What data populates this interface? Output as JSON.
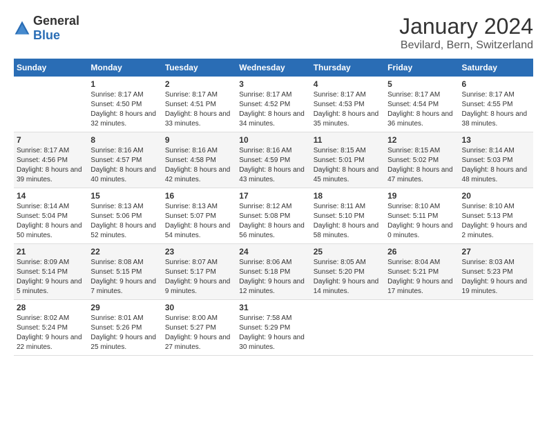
{
  "logo": {
    "general": "General",
    "blue": "Blue"
  },
  "title": "January 2024",
  "subtitle": "Bevilard, Bern, Switzerland",
  "days_header": [
    "Sunday",
    "Monday",
    "Tuesday",
    "Wednesday",
    "Thursday",
    "Friday",
    "Saturday"
  ],
  "weeks": [
    [
      {
        "day": "",
        "sunrise": "",
        "sunset": "",
        "daylight": ""
      },
      {
        "day": "1",
        "sunrise": "Sunrise: 8:17 AM",
        "sunset": "Sunset: 4:50 PM",
        "daylight": "Daylight: 8 hours and 32 minutes."
      },
      {
        "day": "2",
        "sunrise": "Sunrise: 8:17 AM",
        "sunset": "Sunset: 4:51 PM",
        "daylight": "Daylight: 8 hours and 33 minutes."
      },
      {
        "day": "3",
        "sunrise": "Sunrise: 8:17 AM",
        "sunset": "Sunset: 4:52 PM",
        "daylight": "Daylight: 8 hours and 34 minutes."
      },
      {
        "day": "4",
        "sunrise": "Sunrise: 8:17 AM",
        "sunset": "Sunset: 4:53 PM",
        "daylight": "Daylight: 8 hours and 35 minutes."
      },
      {
        "day": "5",
        "sunrise": "Sunrise: 8:17 AM",
        "sunset": "Sunset: 4:54 PM",
        "daylight": "Daylight: 8 hours and 36 minutes."
      },
      {
        "day": "6",
        "sunrise": "Sunrise: 8:17 AM",
        "sunset": "Sunset: 4:55 PM",
        "daylight": "Daylight: 8 hours and 38 minutes."
      }
    ],
    [
      {
        "day": "7",
        "sunrise": "Sunrise: 8:17 AM",
        "sunset": "Sunset: 4:56 PM",
        "daylight": "Daylight: 8 hours and 39 minutes."
      },
      {
        "day": "8",
        "sunrise": "Sunrise: 8:16 AM",
        "sunset": "Sunset: 4:57 PM",
        "daylight": "Daylight: 8 hours and 40 minutes."
      },
      {
        "day": "9",
        "sunrise": "Sunrise: 8:16 AM",
        "sunset": "Sunset: 4:58 PM",
        "daylight": "Daylight: 8 hours and 42 minutes."
      },
      {
        "day": "10",
        "sunrise": "Sunrise: 8:16 AM",
        "sunset": "Sunset: 4:59 PM",
        "daylight": "Daylight: 8 hours and 43 minutes."
      },
      {
        "day": "11",
        "sunrise": "Sunrise: 8:15 AM",
        "sunset": "Sunset: 5:01 PM",
        "daylight": "Daylight: 8 hours and 45 minutes."
      },
      {
        "day": "12",
        "sunrise": "Sunrise: 8:15 AM",
        "sunset": "Sunset: 5:02 PM",
        "daylight": "Daylight: 8 hours and 47 minutes."
      },
      {
        "day": "13",
        "sunrise": "Sunrise: 8:14 AM",
        "sunset": "Sunset: 5:03 PM",
        "daylight": "Daylight: 8 hours and 48 minutes."
      }
    ],
    [
      {
        "day": "14",
        "sunrise": "Sunrise: 8:14 AM",
        "sunset": "Sunset: 5:04 PM",
        "daylight": "Daylight: 8 hours and 50 minutes."
      },
      {
        "day": "15",
        "sunrise": "Sunrise: 8:13 AM",
        "sunset": "Sunset: 5:06 PM",
        "daylight": "Daylight: 8 hours and 52 minutes."
      },
      {
        "day": "16",
        "sunrise": "Sunrise: 8:13 AM",
        "sunset": "Sunset: 5:07 PM",
        "daylight": "Daylight: 8 hours and 54 minutes."
      },
      {
        "day": "17",
        "sunrise": "Sunrise: 8:12 AM",
        "sunset": "Sunset: 5:08 PM",
        "daylight": "Daylight: 8 hours and 56 minutes."
      },
      {
        "day": "18",
        "sunrise": "Sunrise: 8:11 AM",
        "sunset": "Sunset: 5:10 PM",
        "daylight": "Daylight: 8 hours and 58 minutes."
      },
      {
        "day": "19",
        "sunrise": "Sunrise: 8:10 AM",
        "sunset": "Sunset: 5:11 PM",
        "daylight": "Daylight: 9 hours and 0 minutes."
      },
      {
        "day": "20",
        "sunrise": "Sunrise: 8:10 AM",
        "sunset": "Sunset: 5:13 PM",
        "daylight": "Daylight: 9 hours and 2 minutes."
      }
    ],
    [
      {
        "day": "21",
        "sunrise": "Sunrise: 8:09 AM",
        "sunset": "Sunset: 5:14 PM",
        "daylight": "Daylight: 9 hours and 5 minutes."
      },
      {
        "day": "22",
        "sunrise": "Sunrise: 8:08 AM",
        "sunset": "Sunset: 5:15 PM",
        "daylight": "Daylight: 9 hours and 7 minutes."
      },
      {
        "day": "23",
        "sunrise": "Sunrise: 8:07 AM",
        "sunset": "Sunset: 5:17 PM",
        "daylight": "Daylight: 9 hours and 9 minutes."
      },
      {
        "day": "24",
        "sunrise": "Sunrise: 8:06 AM",
        "sunset": "Sunset: 5:18 PM",
        "daylight": "Daylight: 9 hours and 12 minutes."
      },
      {
        "day": "25",
        "sunrise": "Sunrise: 8:05 AM",
        "sunset": "Sunset: 5:20 PM",
        "daylight": "Daylight: 9 hours and 14 minutes."
      },
      {
        "day": "26",
        "sunrise": "Sunrise: 8:04 AM",
        "sunset": "Sunset: 5:21 PM",
        "daylight": "Daylight: 9 hours and 17 minutes."
      },
      {
        "day": "27",
        "sunrise": "Sunrise: 8:03 AM",
        "sunset": "Sunset: 5:23 PM",
        "daylight": "Daylight: 9 hours and 19 minutes."
      }
    ],
    [
      {
        "day": "28",
        "sunrise": "Sunrise: 8:02 AM",
        "sunset": "Sunset: 5:24 PM",
        "daylight": "Daylight: 9 hours and 22 minutes."
      },
      {
        "day": "29",
        "sunrise": "Sunrise: 8:01 AM",
        "sunset": "Sunset: 5:26 PM",
        "daylight": "Daylight: 9 hours and 25 minutes."
      },
      {
        "day": "30",
        "sunrise": "Sunrise: 8:00 AM",
        "sunset": "Sunset: 5:27 PM",
        "daylight": "Daylight: 9 hours and 27 minutes."
      },
      {
        "day": "31",
        "sunrise": "Sunrise: 7:58 AM",
        "sunset": "Sunset: 5:29 PM",
        "daylight": "Daylight: 9 hours and 30 minutes."
      },
      {
        "day": "",
        "sunrise": "",
        "sunset": "",
        "daylight": ""
      },
      {
        "day": "",
        "sunrise": "",
        "sunset": "",
        "daylight": ""
      },
      {
        "day": "",
        "sunrise": "",
        "sunset": "",
        "daylight": ""
      }
    ]
  ]
}
